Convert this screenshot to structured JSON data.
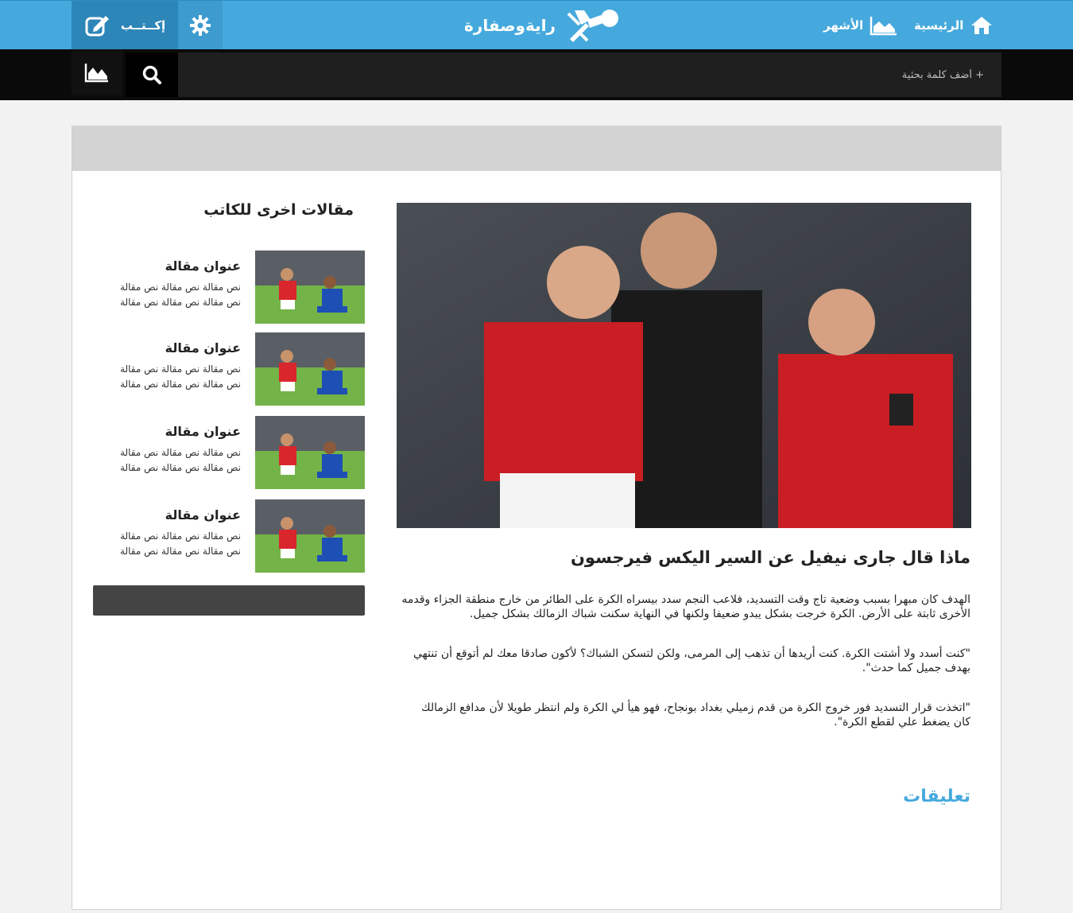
{
  "topbar": {
    "nav": [
      {
        "label": "الرئيسية",
        "icon": "home-icon"
      },
      {
        "label": "الأشهر",
        "icon": "chart-icon"
      }
    ],
    "logo_text": "رايةوصفارة",
    "write_label": "إكــتــب"
  },
  "search": {
    "placeholder": "+ أضف كلمة بحثية"
  },
  "article": {
    "title": "ماذا قال جارى نيفيل عن السير اليكس فيرجسون",
    "paragraphs": [
      "الهدف كان مبهرا بسبب وضعية تاج وقت التسديد، فلاعب النجم سدد بيسراه الكرة على الطائر من خارج منطقة الجزاء وقدمه الأخرى ثابتة على الأرض. الكرة خرجت بشكل يبدو ضعيفا ولكنها في النهاية سكنت شباك الزمالك بشكل جميل.",
      "\"كنت أسدد ولا أشتت الكرة. كنت أريدها أن تذهب إلى المرمى، ولكن لتسكن الشباك؟ لأكون صادقا معك لم أتوقع أن تنتهي بهدف جميل كما حدث\".",
      "\"اتخذت قرار التسديد فور خروج الكرة من قدم زميلي بغداد بونجاح، فهو هيأ لي الكرة ولم انتظر طويلا لأن مدافع الزمالك كان يضغط علي لقطع الكرة\"."
    ],
    "comments_title": "تعليقات"
  },
  "sidebar": {
    "title": "مقالات اخرى للكاتب",
    "items": [
      {
        "title": "عنوان مقالة",
        "line1": "نص مقالة نص مقالة نص مقالة",
        "line2": "نص مقالة نص مقالة نص مقالة"
      },
      {
        "title": "عنوان مقالة",
        "line1": "نص مقالة نص مقالة نص مقالة",
        "line2": "نص مقالة نص مقالة نص مقالة"
      },
      {
        "title": "عنوان مقالة",
        "line1": "نص مقالة نص مقالة نص مقالة",
        "line2": "نص مقالة نص مقالة نص مقالة"
      },
      {
        "title": "عنوان مقالة",
        "line1": "نص مقالة نص مقالة نص مقالة",
        "line2": "نص مقالة نص مقالة نص مقالة"
      }
    ]
  },
  "colors": {
    "brand_blue": "#45a9dd",
    "dark_bar": "#0a0a0a",
    "accent_text": "#45a9dd"
  }
}
